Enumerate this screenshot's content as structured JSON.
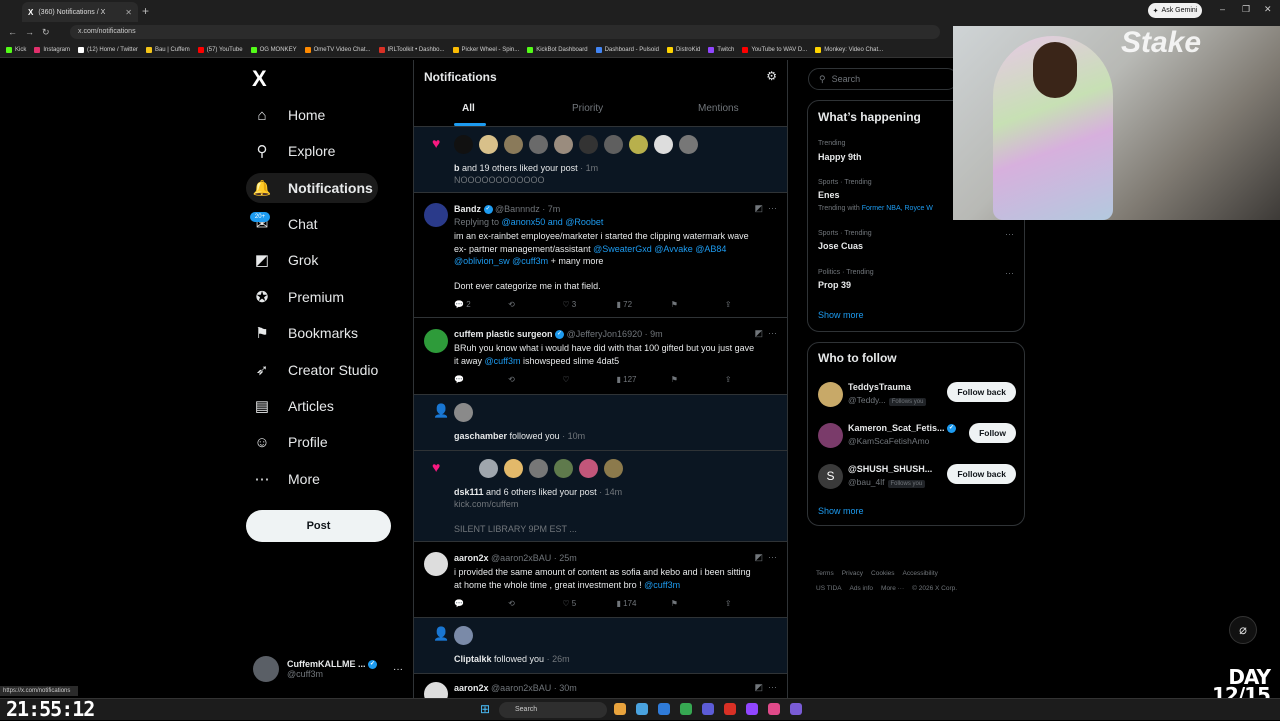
{
  "browser": {
    "tab_title": "(360) Notifications / X",
    "tab_logo": "X",
    "new_tab": "+",
    "ask_gemini": "Ask Gemini",
    "url": "x.com/notifications",
    "bookmarks": [
      {
        "label": "Kick",
        "color": "#53fc18"
      },
      {
        "label": "Instagram",
        "color": "#e1306c"
      },
      {
        "label": "(12) Home / Twitter",
        "color": "#ffffff"
      },
      {
        "label": "Bau | Cuffem",
        "color": "#f5c518"
      },
      {
        "label": "(57) YouTube",
        "color": "#ff0000"
      },
      {
        "label": "OG MONKEY",
        "color": "#53fc18"
      },
      {
        "label": "OmeTV Video Chat...",
        "color": "#ff8a00"
      },
      {
        "label": "IRLToolkit • Dashbo...",
        "color": "#d93025"
      },
      {
        "label": "Picker Wheel - Spin...",
        "color": "#fbbc04"
      },
      {
        "label": "KickBot Dashboard",
        "color": "#53fc18"
      },
      {
        "label": "Dashboard - Pulsoid",
        "color": "#4285f4"
      },
      {
        "label": "DistroKid",
        "color": "#ffd400"
      },
      {
        "label": "Twitch",
        "color": "#9146ff"
      },
      {
        "label": "YouTube to WAV D...",
        "color": "#ff0000"
      },
      {
        "label": "Monkey: Video Chat...",
        "color": "#ffd400"
      }
    ],
    "status_url": "https://x.com/notifications"
  },
  "nav": {
    "logo": "X",
    "items": [
      {
        "label": "Home",
        "icon": "home-icon",
        "glyph": "⌂"
      },
      {
        "label": "Explore",
        "icon": "search-icon",
        "glyph": "⚲"
      },
      {
        "label": "Notifications",
        "icon": "bell-icon",
        "glyph": "🔔"
      },
      {
        "label": "Chat",
        "icon": "chat-icon",
        "glyph": "✉"
      },
      {
        "label": "Grok",
        "icon": "grok-icon",
        "glyph": "◩"
      },
      {
        "label": "Premium",
        "icon": "premium-icon",
        "glyph": "✪"
      },
      {
        "label": "Bookmarks",
        "icon": "bookmark-icon",
        "glyph": "⚑"
      },
      {
        "label": "Creator Studio",
        "icon": "rocket-icon",
        "glyph": "➶"
      },
      {
        "label": "Articles",
        "icon": "articles-icon",
        "glyph": "▤"
      },
      {
        "label": "Profile",
        "icon": "profile-icon",
        "glyph": "☺"
      },
      {
        "label": "More",
        "icon": "more-icon",
        "glyph": "⋯"
      }
    ],
    "chat_badge": "20+",
    "post_button": "Post",
    "account": {
      "name": "CuffemKALLME ...",
      "handle": "@cuff3m",
      "more": "···"
    }
  },
  "main": {
    "title": "Notifications",
    "tabs": [
      "All",
      "Priority",
      "Mentions"
    ],
    "n1": {
      "actor": "b",
      "text": "and 19 others liked your post",
      "time": "· 1m",
      "quote": "NOOOOOOOOOOOO"
    },
    "t1": {
      "name": "Bandz",
      "handle": "@Bannndz",
      "time": "· 7m",
      "replying_label": "Replying to",
      "replying_to": "@anonx50 and @Roobet",
      "body1": "im an ex-rainbet employee/marketer i started the clipping watermark wave",
      "body2_text": "ex- partner management/assistant",
      "body2_links": "@SweaterGxd @Avvake @AB84",
      "body3_links": "@oblivion_sw @cuff3m",
      "body3_text": "+ many more",
      "body4": "Dont ever categorize me in that field.",
      "replies": "2",
      "likes": "3",
      "views": "72"
    },
    "t2": {
      "name": "cuffem plastic surgeon",
      "handle": "@JefferyJon16920",
      "time": "· 9m",
      "body1": "BRuh you know what i would have did with that 100 gifted but you just gave",
      "body2_text1": "it away",
      "body2_link": "@cuff3m",
      "body2_text2": "ishowspeed slime 4dat5",
      "views": "127"
    },
    "n2": {
      "actor": "gaschamber",
      "text": "followed you",
      "time": "· 10m"
    },
    "n3": {
      "actor": "dsk111",
      "text": "and 6 others liked your post",
      "time": "· 14m",
      "quote1": "kick.com/cuffem",
      "quote2": "SILENT LIBRARY 9PM EST ..."
    },
    "t3": {
      "name": "aaron2x",
      "handle": "@aaron2xBAU",
      "time": "· 25m",
      "body1": "i provided the same amount of content as sofia and kebo and i been sitting",
      "body2_text": "at home the whole time , great investment bro !",
      "body2_link": "@cuff3m",
      "likes": "5",
      "views": "174"
    },
    "n4": {
      "actor": "Cliptalkk",
      "text": "followed you",
      "time": "· 26m"
    },
    "t4": {
      "name": "aaron2x",
      "handle": "@aaron2xBAU",
      "time": "· 30m"
    }
  },
  "right": {
    "search_placeholder": "Search",
    "happening_title": "What’s happening",
    "trends": [
      {
        "meta": "Trending",
        "title": "Happy 9th"
      },
      {
        "meta": "Sports · Trending",
        "title": "Enes",
        "sub_label": "Trending with",
        "sub_links": "Former NBA, Royce W"
      },
      {
        "meta": "Sports · Trending",
        "title": "Jose Cuas"
      },
      {
        "meta": "Politics · Trending",
        "title": "Prop 39"
      }
    ],
    "show_more": "Show more",
    "wtf_title": "Who to follow",
    "wtf": [
      {
        "name": "TeddysTrauma",
        "handle": "@Teddy...",
        "follows_you": "Follows you",
        "button": "Follow back"
      },
      {
        "name": "Kameron_Scat_Fetis...",
        "handle": "@KamScaFetishAmo",
        "button": "Follow"
      },
      {
        "name": "@SHUSH_SHUSH...",
        "handle": "@bau_4lf",
        "follows_you": "Follows you",
        "button": "Follow back"
      }
    ],
    "footer": [
      "Terms",
      "Privacy",
      "Cookies",
      "Accessibility",
      "US TIDA",
      "Ads info",
      "More ···",
      "© 2026 X Corp."
    ]
  },
  "overlay": {
    "clock": "21:55:12",
    "day_line1": "DAY",
    "day_line2": "12/15",
    "webcam_brand": "Stake"
  },
  "taskbar": {
    "search": "Search"
  }
}
